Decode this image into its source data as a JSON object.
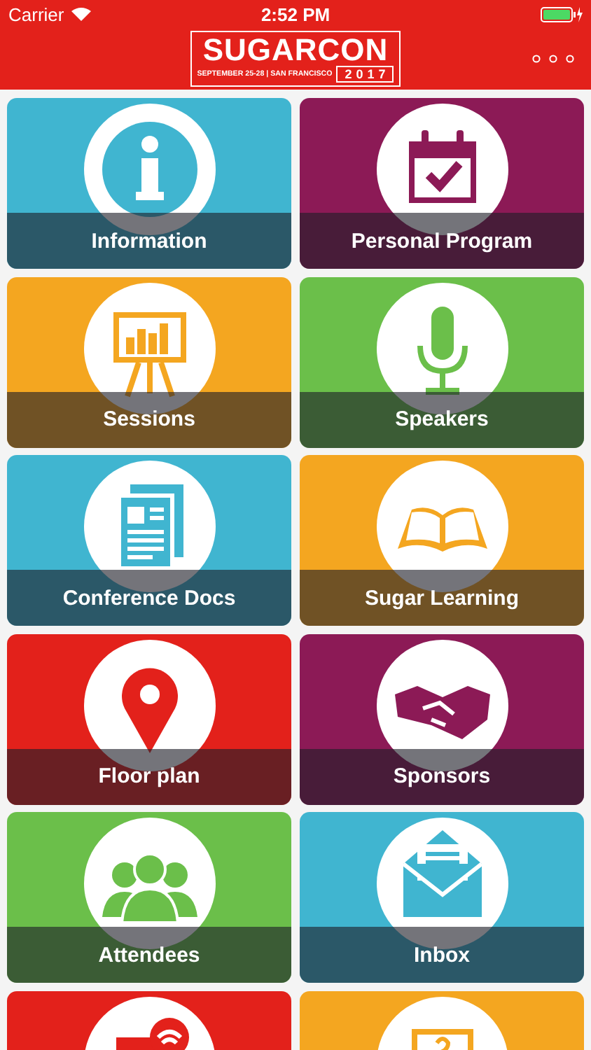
{
  "status_bar": {
    "carrier": "Carrier",
    "time": "2:52 PM"
  },
  "header": {
    "logo": {
      "title": "SUGARCON",
      "tagline": "SEPTEMBER 25-28 | SAN FRANCISCO",
      "year": "2017"
    }
  },
  "tiles": [
    {
      "label": "Information",
      "color": "#40b5d0"
    },
    {
      "label": "Personal Program",
      "color": "#8c1a56"
    },
    {
      "label": "Sessions",
      "color": "#f4a620"
    },
    {
      "label": "Speakers",
      "color": "#6bbf4a"
    },
    {
      "label": "Conference Docs",
      "color": "#40b5d0"
    },
    {
      "label": "Sugar Learning",
      "color": "#f4a620"
    },
    {
      "label": "Floor plan",
      "color": "#e3211b"
    },
    {
      "label": "Sponsors",
      "color": "#8c1a56"
    },
    {
      "label": "Attendees",
      "color": "#6bbf4a"
    },
    {
      "label": "Inbox",
      "color": "#40b5d0"
    },
    {
      "color": "#e3211b"
    },
    {
      "color": "#f4a620"
    }
  ]
}
